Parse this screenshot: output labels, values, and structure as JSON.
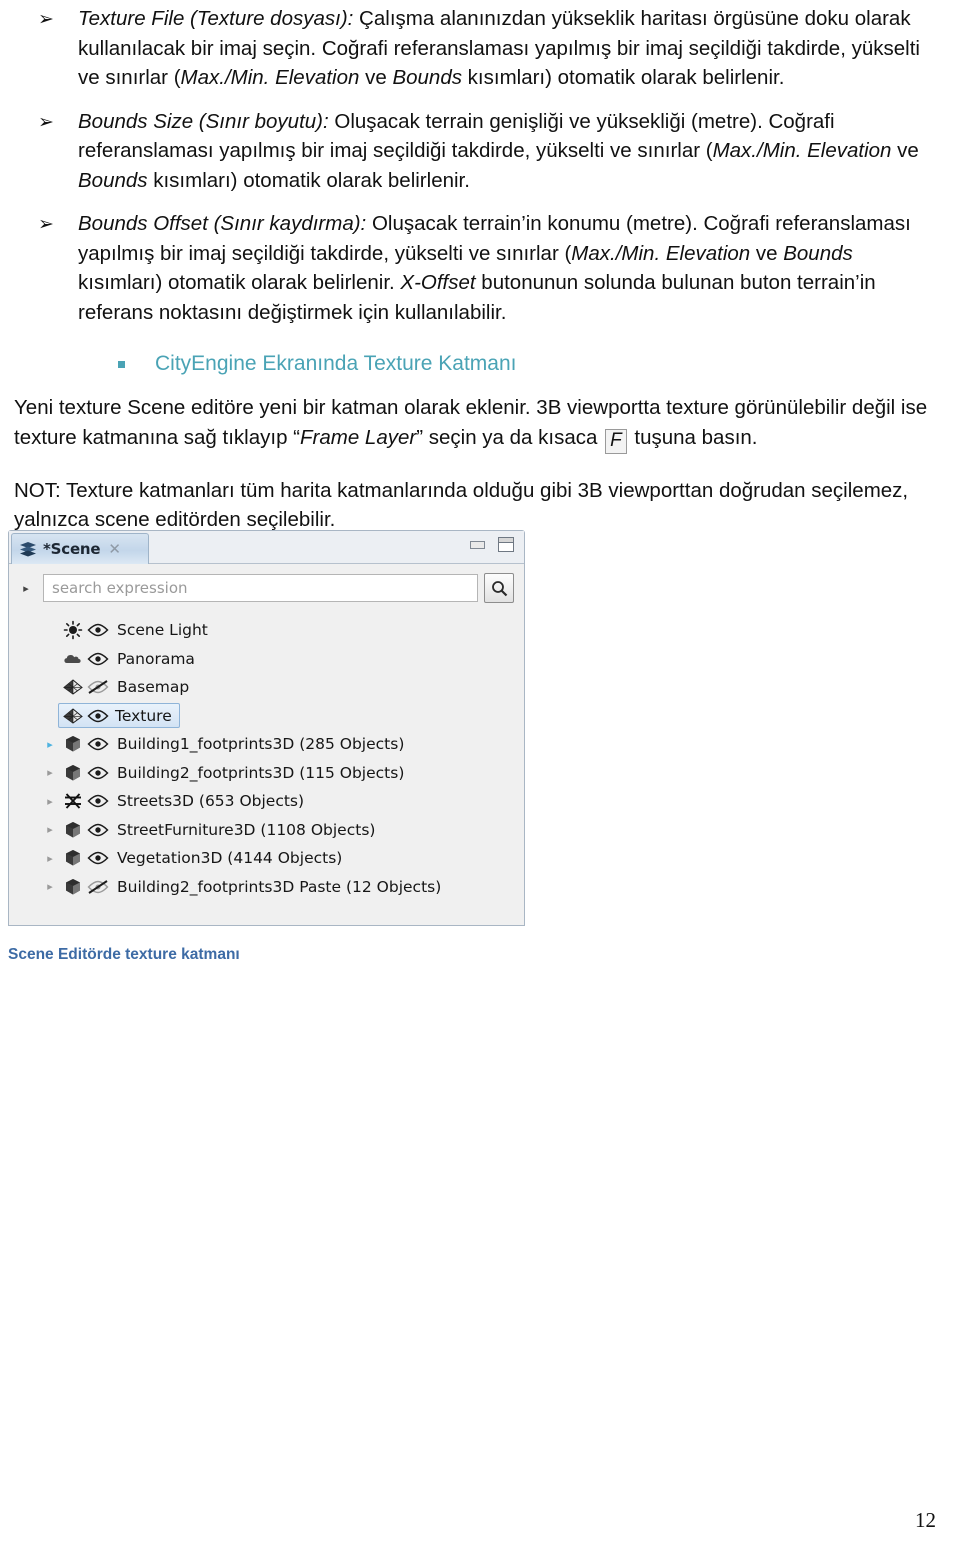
{
  "document": {
    "bullets": [
      {
        "marker": "➢",
        "term": "Texture File (Texture dosyası):",
        "text_a": " Çalışma alanınızdan yükseklik haritası örgüsüne doku olarak kullanılacak bir imaj seçin. Coğrafi referanslaması yapılmış bir imaj seçildiği takdirde, yükselti ve sınırlar (",
        "em_a": "Max./Min. Elevation",
        "text_b": " ve ",
        "em_b": "Bounds",
        "text_c": " kısımları) otomatik olarak belirlenir."
      },
      {
        "marker": "➢",
        "term": "Bounds Size (Sınır boyutu):",
        "text_a": " Oluşacak terrain genişliği ve yüksekliği (metre). Coğrafi referanslaması yapılmış bir imaj seçildiği takdirde, yükselti ve sınırlar (",
        "em_a": "Max./Min. Elevation",
        "text_b": " ve ",
        "em_b": "Bounds",
        "text_c": " kısımları) otomatik olarak belirlenir."
      },
      {
        "marker": "➢",
        "term": "Bounds Offset (Sınır kaydırma):",
        "text_a": " Oluşacak terrain’in konumu (metre). Coğrafi referanslaması yapılmış bir imaj seçildiği takdirde, yükselti ve sınırlar (",
        "em_a": "Max./Min. Elevation",
        "text_b": " ve ",
        "em_b": "Bounds",
        "text_c": " kısımları) otomatik olarak belirlenir. ",
        "em_c": "X-Offset",
        "text_d": " butonunun solunda bulunan buton terrain’in referans noktasını değiştirmek için kullanılabilir."
      }
    ],
    "subheading": {
      "text": "CityEngine Ekranında Texture Katmanı",
      "color": "#4aa3b5"
    },
    "paragraph_1": {
      "part_a": "Yeni texture Scene editöre yeni bir katman olarak eklenir. 3B viewportta texture görünülebilir değil ise texture katmanına sağ tıklayıp “",
      "em_a": "Frame Layer",
      "part_b": "” seçin ya da kısaca ",
      "keycap": "F",
      "part_c": " tuşuna basın."
    },
    "paragraph_2": "NOT: Texture katmanları tüm harita katmanlarında olduğu gibi 3B viewporttan doğrudan seçilemez, yalnızca scene editörden seçilebilir.",
    "figure_caption": "Scene Editörde texture katmanı",
    "page_number": "12"
  },
  "scene_panel": {
    "tab": {
      "label": "*Scene",
      "close_glyph": "✕",
      "icon": "layers-stack-icon"
    },
    "window_controls": {
      "minimize": "minimize-icon",
      "maximize": "maximize-icon"
    },
    "search": {
      "expand_glyph": "▸",
      "placeholder": "search expression",
      "value": "",
      "button_icon": "search-icon"
    },
    "tree": [
      {
        "twisty": "",
        "icon": "sun-icon",
        "eye": "visible",
        "label": "Scene Light",
        "selected": false
      },
      {
        "twisty": "",
        "icon": "cloud-icon",
        "eye": "visible",
        "label": "Panorama",
        "selected": false
      },
      {
        "twisty": "",
        "icon": "terrain-icon",
        "eye": "hidden",
        "label": "Basemap",
        "selected": false
      },
      {
        "twisty": "",
        "icon": "terrain-icon",
        "eye": "visible",
        "label": "Texture",
        "selected": true
      },
      {
        "twisty": "▸",
        "icon": "cube-icon",
        "eye": "visible",
        "label": "Building1_footprints3D (285 Objects)",
        "selected": false,
        "twisty_active": true
      },
      {
        "twisty": "▸",
        "icon": "cube-icon",
        "eye": "visible",
        "label": "Building2_footprints3D (115 Objects)",
        "selected": false
      },
      {
        "twisty": "▸",
        "icon": "streets-icon",
        "eye": "visible",
        "label": "Streets3D (653 Objects)",
        "selected": false
      },
      {
        "twisty": "▸",
        "icon": "cube-icon",
        "eye": "visible",
        "label": "StreetFurniture3D (1108 Objects)",
        "selected": false
      },
      {
        "twisty": "▸",
        "icon": "cube-icon",
        "eye": "visible",
        "label": "Vegetation3D (4144 Objects)",
        "selected": false
      },
      {
        "twisty": "▸",
        "icon": "cube-icon",
        "eye": "hidden",
        "label": "Building2_footprints3D Paste (12 Objects)",
        "selected": false
      }
    ]
  }
}
